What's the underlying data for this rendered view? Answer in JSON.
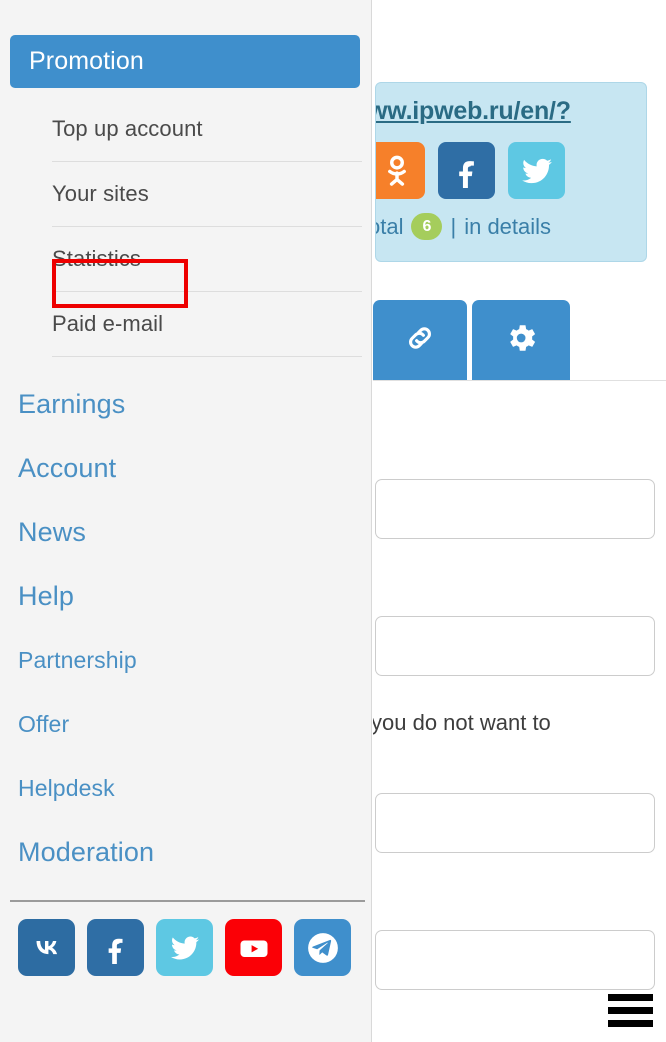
{
  "sidebar": {
    "section": {
      "title": "Promotion",
      "icon": "section-header",
      "color": "#3f8fcc"
    },
    "submenu": [
      {
        "label": "Top up account",
        "icon": "submenu-item-icon",
        "highlighted": false
      },
      {
        "label": "Your sites",
        "icon": "submenu-item-icon",
        "highlighted": true
      },
      {
        "label": "Statistics",
        "icon": "submenu-item-icon",
        "highlighted": false
      },
      {
        "label": "Paid e-mail",
        "icon": "submenu-item-icon",
        "highlighted": false
      }
    ],
    "highlight_color": "#ee0000",
    "nav": [
      {
        "label": "Earnings",
        "size": "lg"
      },
      {
        "label": "Account",
        "size": "lg"
      },
      {
        "label": "News",
        "size": "lg"
      },
      {
        "label": "Help",
        "size": "lg"
      },
      {
        "label": "Partnership",
        "size": "md"
      },
      {
        "label": "Offer",
        "size": "md"
      },
      {
        "label": "Helpdesk",
        "size": "md"
      },
      {
        "label": "Moderation",
        "size": "xl"
      }
    ],
    "nav_link_color": "#4a90c4",
    "social": [
      {
        "name": "vk-icon",
        "label": "VK",
        "color": "#2d6ca2"
      },
      {
        "name": "facebook-icon",
        "label": "Facebook",
        "color": "#2f6ea5"
      },
      {
        "name": "twitter-icon",
        "label": "Twitter",
        "color": "#5ec8e3"
      },
      {
        "name": "youtube-icon",
        "label": "YouTube",
        "color": "#fb0006"
      },
      {
        "name": "telegram-icon",
        "label": "Telegram",
        "color": "#3f8fcc"
      }
    ]
  },
  "content": {
    "referral_card": {
      "link_text": "ww.ipweb.ru/en/?",
      "background": "#c7e6f2",
      "share": [
        {
          "name": "odnoklassniki-icon",
          "label": "Odnoklassniki",
          "color": "#f6802a"
        },
        {
          "name": "facebook-icon",
          "label": "Facebook",
          "color": "#2f6ea5"
        },
        {
          "name": "twitter-icon",
          "label": "Twitter",
          "color": "#5ec8e3"
        }
      ],
      "total_label": "otal",
      "total_count": "6",
      "separator": "|",
      "details_label": "in details",
      "badge_color": "#a5cd5c"
    },
    "tabs": [
      {
        "name": "link-icon",
        "label": "Links",
        "active": true
      },
      {
        "name": "gear-icon",
        "label": "Settings",
        "active": true
      }
    ],
    "fields": [
      {
        "name": "field-1",
        "value": "",
        "placeholder": ""
      },
      {
        "name": "field-2",
        "value": "",
        "placeholder": ""
      },
      {
        "name": "field-3",
        "value": "",
        "placeholder": ""
      },
      {
        "name": "field-4",
        "value": "",
        "placeholder": ""
      }
    ],
    "note_text": "you do not want to",
    "menu_icon": "hamburger-menu-icon"
  }
}
